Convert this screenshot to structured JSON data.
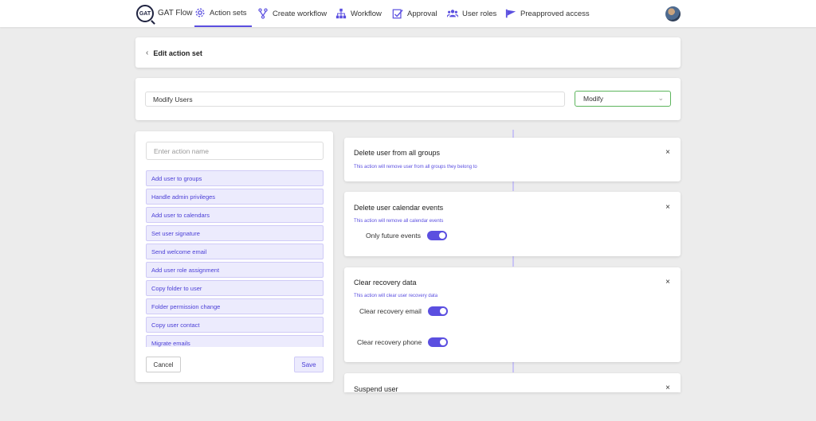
{
  "nav": {
    "logo_text": "GAT",
    "brand": "GAT Flow",
    "items": [
      {
        "label": "Action sets",
        "icon": "gear-icon",
        "active": true
      },
      {
        "label": "Create workflow",
        "icon": "branch-icon",
        "active": false
      },
      {
        "label": "Workflow",
        "icon": "hierarchy-icon",
        "active": false
      },
      {
        "label": "Approval",
        "icon": "approval-icon",
        "active": false
      },
      {
        "label": "User roles",
        "icon": "users-icon",
        "active": false
      },
      {
        "label": "Preapproved access",
        "icon": "flag-icon",
        "active": false
      }
    ],
    "accent_color": "#5b4fe0"
  },
  "header": {
    "back_label": "Edit action set"
  },
  "action_set": {
    "name_value": "Modify Users",
    "type_selected": "Modify"
  },
  "actions_panel": {
    "search_placeholder": "Enter action name",
    "items": [
      "Add user to groups",
      "Handle admin privileges",
      "Add user to calendars",
      "Set user signature",
      "Send welcome email",
      "Add user role assignment",
      "Copy folder to user",
      "Folder permission change",
      "Copy user contact",
      "Migrate emails"
    ],
    "cancel_label": "Cancel",
    "save_label": "Save"
  },
  "steps": [
    {
      "title": "Delete user from all groups",
      "description": "This action will remove user from all groups they belong to",
      "close": "×"
    },
    {
      "title": "Delete user calendar events",
      "description": "This action will remove all calendar events",
      "close": "×",
      "toggles": [
        {
          "label": "Only future events",
          "on": true
        }
      ]
    },
    {
      "title": "Clear recovery data",
      "description": "This action will clear user recovery data",
      "close": "×",
      "toggles": [
        {
          "label": "Clear recovery email",
          "on": true
        },
        {
          "label": "Clear recovery phone",
          "on": true
        }
      ]
    },
    {
      "title": "Suspend user",
      "close": "×"
    }
  ]
}
